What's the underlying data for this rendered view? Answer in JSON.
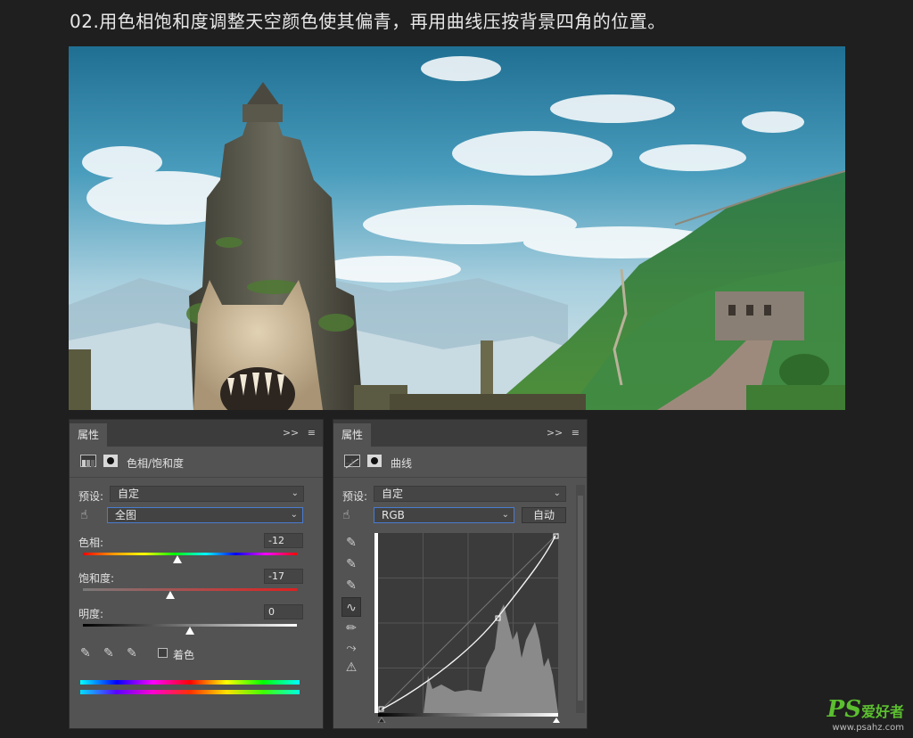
{
  "heading": "02.用色相饱和度调整天空颜色使其偏青，再用曲线压按背景四角的位置。",
  "panel_hue": {
    "tab": "属性",
    "controls": [
      ">>",
      "≡"
    ],
    "title": "色相/饱和度",
    "preset_label": "预设:",
    "preset_value": "自定",
    "channel_value": "全图",
    "hue_label": "色相:",
    "hue_value": "-12",
    "sat_label": "饱和度:",
    "sat_value": "-17",
    "light_label": "明度:",
    "light_value": "0",
    "colorize_label": "着色",
    "hue_level": 0.44,
    "sat_level": 0.41,
    "light_level": 0.5
  },
  "panel_curves": {
    "tab": "属性",
    "controls": [
      ">>",
      "≡"
    ],
    "title": "曲线",
    "preset_label": "预设:",
    "preset_value": "自定",
    "channel_value": "RGB",
    "auto_label": "自动"
  },
  "watermark": {
    "brand": "PS",
    "cn": "爱好者",
    "url": "www.psahz.com"
  },
  "icons": {
    "hand": "hand-target-icon",
    "eyedropper": "eyedropper-icon",
    "pencil": "pencil-icon",
    "curve": "curve-icon",
    "warning": "clipping-warning-icon"
  }
}
